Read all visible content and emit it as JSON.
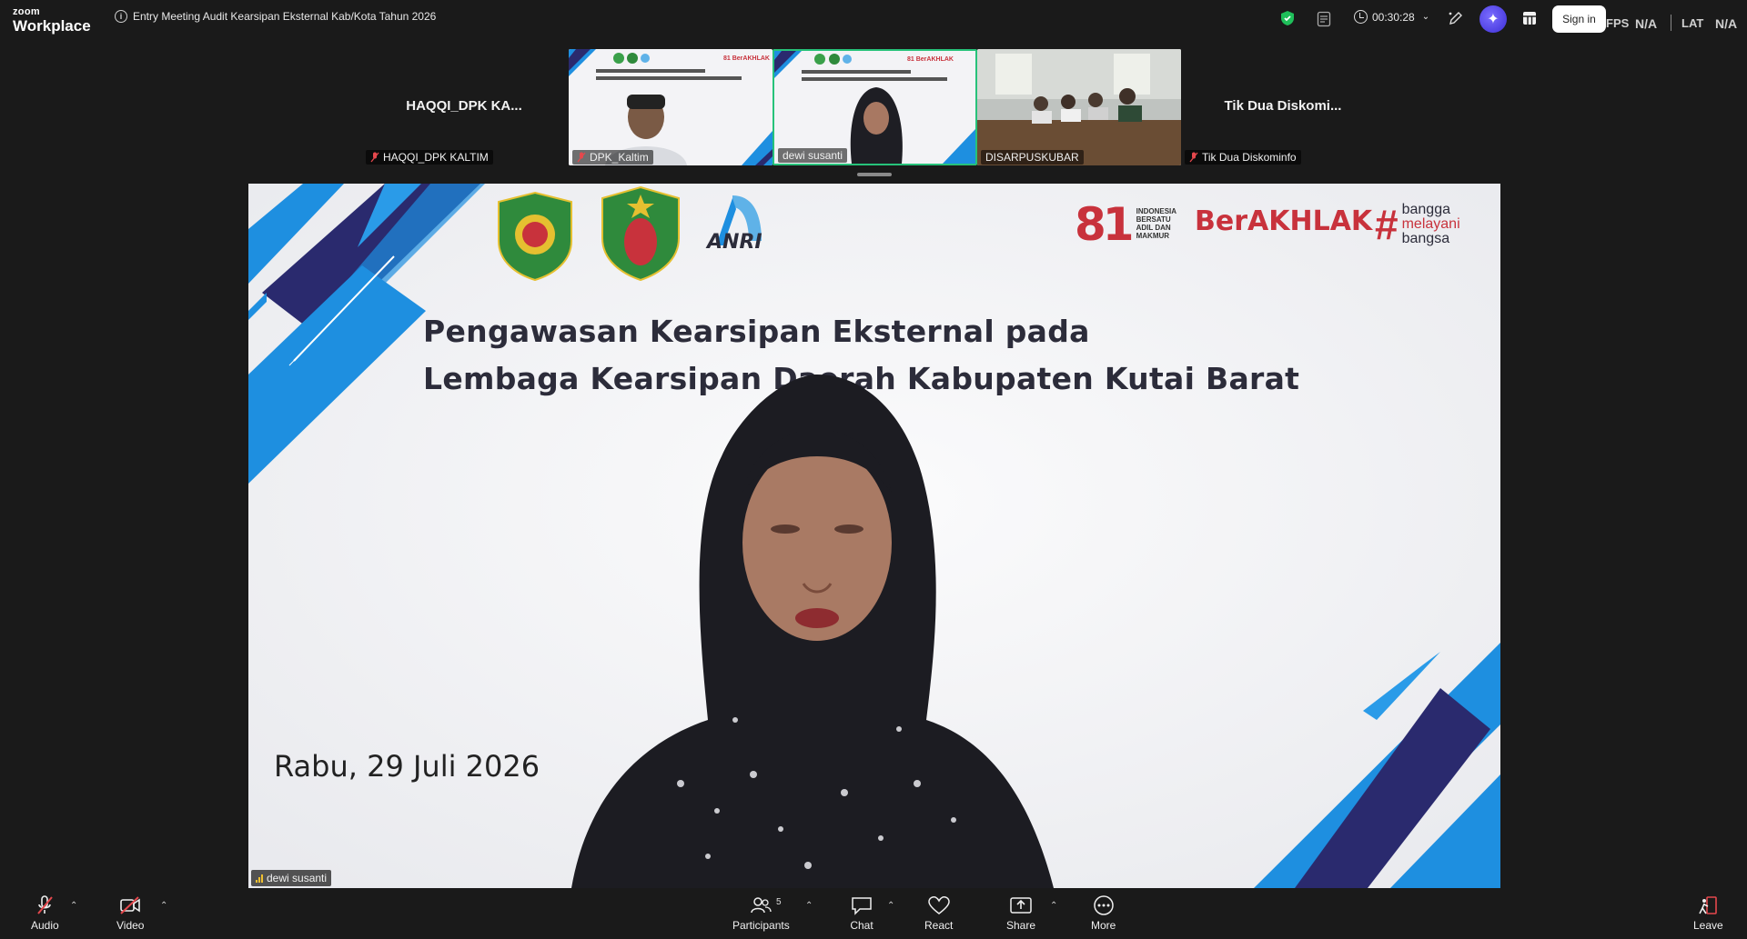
{
  "app": {
    "brand_small": "zoom",
    "brand_large": "Workplace"
  },
  "meeting": {
    "title": "Entry Meeting Audit Kearsipan Eksternal Kab/Kota Tahun 2026",
    "elapsed": "00:30:28"
  },
  "topbar": {
    "sign_in": "Sign in",
    "fps_label": "FPS",
    "fps_value": "N/A",
    "lat_label": "LAT",
    "lat_value": "N/A"
  },
  "participants_strip": [
    {
      "display_big": "HAQQI_DPK KA...",
      "label": "HAQQI_DPK KALTIM",
      "muted": true,
      "video": false
    },
    {
      "label": "DPK_Kaltim",
      "muted": true,
      "video": true
    },
    {
      "label": "dewi susanti",
      "muted": false,
      "video": true,
      "active": true
    },
    {
      "label": "DISARPUSKUBAR",
      "muted": false,
      "video": true
    },
    {
      "display_big": "Tik Dua Diskomi...",
      "label": "Tik Dua Diskominfo",
      "muted": true,
      "video": false
    }
  ],
  "slide": {
    "title_line1": "Pengawasan Kearsipan Eksternal pada",
    "title_line2": "Lembaga Kearsipan Daerah Kabupaten Kutai Barat",
    "date": "Rabu, 29 Juli 2026",
    "logo_anri": "ANRI",
    "badge_81": "81",
    "berakhlak": "BerAKHLAK",
    "bangga_1": "bangga",
    "bangga_2": "melayani",
    "bangga_3": "bangsa",
    "indonesia_text": "INDONESIA BERSATU ADIL DAN MAKMUR"
  },
  "speaker": {
    "name": "dewi susanti"
  },
  "controls": {
    "audio": "Audio",
    "video": "Video",
    "participants": "Participants",
    "participants_count": "5",
    "chat": "Chat",
    "react": "React",
    "share": "Share",
    "more": "More",
    "leave": "Leave"
  },
  "colors": {
    "accent_green": "#27c27a",
    "ai_purple": "#5b4cf0",
    "mute_red": "#e5484d",
    "slide_blue": "#1e8fe0",
    "slide_navy": "#2a2a6e",
    "berakhlak_red": "#c8323c"
  }
}
